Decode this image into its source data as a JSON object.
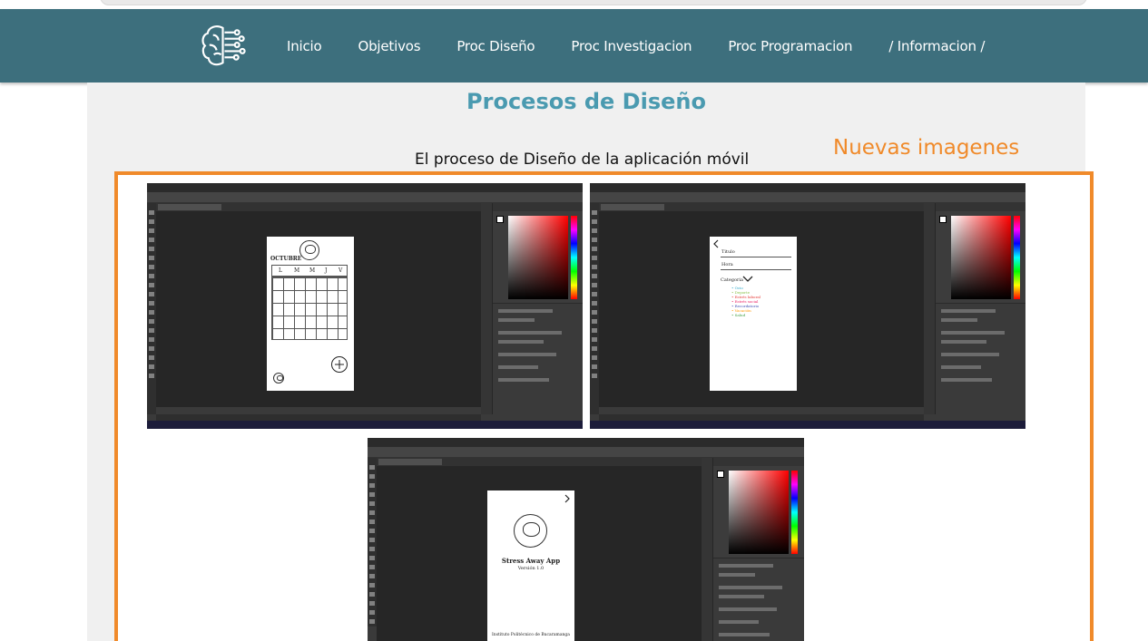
{
  "nav": {
    "logo_icon": "brain-circuit-icon",
    "links": [
      "Inicio",
      "Objetivos",
      "Proc Diseño",
      "Proc Investigacion",
      "Proc Programacion",
      "/ Informacion /"
    ]
  },
  "page": {
    "title": "Procesos de Diseño",
    "subtitle": "El proceso de Diseño de la aplicación móvil",
    "new_images": "Nuevas imagenes"
  },
  "colors": {
    "navbar": "#3d6f7d",
    "title": "#4a9ab0",
    "accent": "#f08a2a",
    "panel": "#f0f0f0"
  },
  "screenshots": {
    "calendar": {
      "month": "OCTUBRE",
      "weekdays": [
        "L",
        "M",
        "M",
        "J",
        "V"
      ],
      "add_icon": "plus-circle-icon"
    },
    "form": {
      "field_title": "Titulo",
      "field_hour": "Hora",
      "field_category": "Categoria",
      "categories": [
        "Ocio",
        "Deporte",
        "Estrés laboral",
        "Estrés social",
        "Recordatorio",
        "Vacación",
        "Salud"
      ],
      "category_colors": [
        "#2aa6c9",
        "#8bc34a",
        "#e53935",
        "#e91e63",
        "#3f51b5",
        "#ff9800",
        "#43a047"
      ]
    },
    "about": {
      "app_name": "Stress Away App",
      "version": "Versión 1.0",
      "institution": "Instituto Politécnico de Bucaramanga"
    }
  }
}
